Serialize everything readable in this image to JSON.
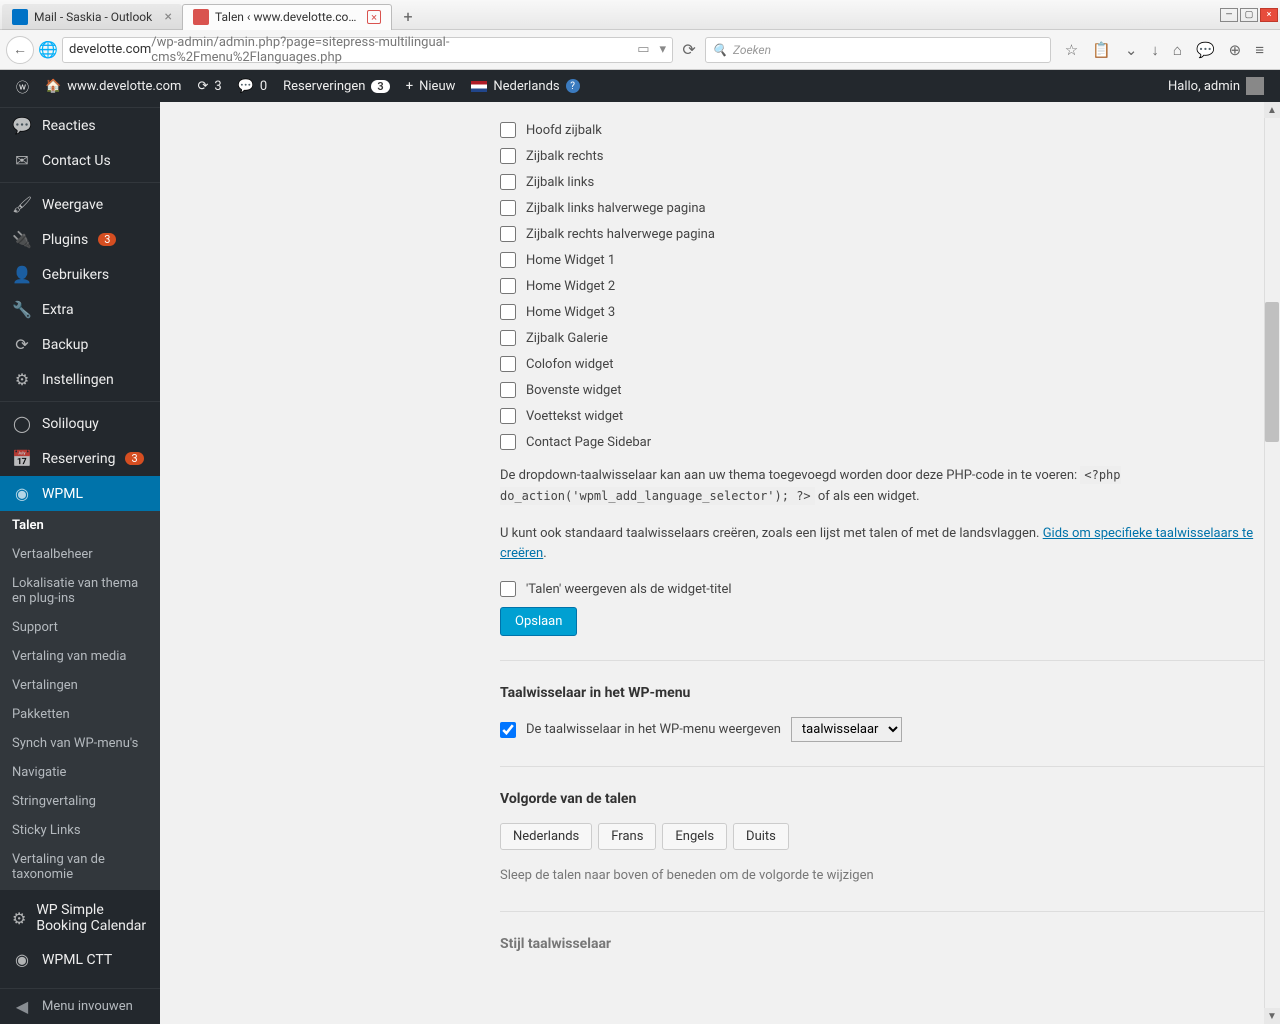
{
  "browser": {
    "tabs": [
      {
        "title": "Mail - Saskia - Outlook",
        "active": false
      },
      {
        "title": "Talen ‹ www.develotte.com — ...",
        "active": true
      }
    ],
    "url_prefix": "develotte.com",
    "url_path": "/wp-admin/admin.php?page=sitepress-multilingual-cms%2Fmenu%2Flanguages.php",
    "search_placeholder": "Zoeken"
  },
  "adminbar": {
    "site": "www.develotte.com",
    "updates": "3",
    "comments": "0",
    "reservations_label": "Reserveringen",
    "reservations_count": "3",
    "new_label": "Nieuw",
    "lang_label": "Nederlands",
    "greeting": "Hallo, admin"
  },
  "sidebar": {
    "items": [
      {
        "icon": "💬",
        "label": "Reacties"
      },
      {
        "icon": "✉",
        "label": "Contact Us"
      },
      {
        "icon": "🖌",
        "label": "Weergave"
      },
      {
        "icon": "🔌",
        "label": "Plugins",
        "badge": "3"
      },
      {
        "icon": "👤",
        "label": "Gebruikers"
      },
      {
        "icon": "🔧",
        "label": "Extra"
      },
      {
        "icon": "⟳",
        "label": "Backup"
      },
      {
        "icon": "⚙",
        "label": "Instellingen"
      },
      {
        "icon": "◯",
        "label": "Soliloquy"
      },
      {
        "icon": "📅",
        "label": "Reservering",
        "badge": "3"
      },
      {
        "icon": "◉",
        "label": "WPML",
        "current": true
      }
    ],
    "submenu": [
      "Talen",
      "Vertaalbeheer",
      "Lokalisatie van thema en plug-ins",
      "Support",
      "Vertaling van media",
      "Vertalingen",
      "Pakketten",
      "Synch van WP-menu's",
      "Navigatie",
      "Stringvertaling",
      "Sticky Links",
      "Vertaling van de taxonomie"
    ],
    "post_submenu": [
      {
        "icon": "⚙",
        "label": "WP Simple Booking Calendar"
      },
      {
        "icon": "◉",
        "label": "WPML CTT"
      }
    ],
    "collapse": "Menu invouwen"
  },
  "content": {
    "checkboxes": [
      "Hoofd zijbalk",
      "Zijbalk rechts",
      "Zijbalk links",
      "Zijbalk links halverwege pagina",
      "Zijbalk rechts halverwege pagina",
      "Home Widget 1",
      "Home Widget 2",
      "Home Widget 3",
      "Zijbalk Galerie",
      "Colofon widget",
      "Bovenste widget",
      "Voettekst widget",
      "Contact Page Sidebar"
    ],
    "dropdown_text1": "De dropdown-taalwisselaar kan aan uw thema toegevoegd worden door deze PHP-code in te voeren: ",
    "dropdown_code": "<?php do_action('wpml_add_language_selector'); ?>",
    "dropdown_text2": " of als een widget.",
    "custom_text": "U kunt ook standaard taalwisselaars creëren, zoals een lijst met talen of met de landsvlaggen. ",
    "custom_link": "Gids om specifieke taalwisselaars te creëren",
    "widget_title_checkbox": "'Talen' weergeven als de widget-titel",
    "save_btn": "Opslaan",
    "menu_section": "Taalwisselaar in het WP-menu",
    "menu_checkbox": "De taalwisselaar in het WP-menu weergeven",
    "menu_select_value": "taalwisselaar",
    "order_section": "Volgorde van de talen",
    "languages": [
      "Nederlands",
      "Frans",
      "Engels",
      "Duits"
    ],
    "order_hint": "Sleep de talen naar boven of beneden om de volgorde te wijzigen",
    "style_section": "Stijl taalwisselaar"
  }
}
